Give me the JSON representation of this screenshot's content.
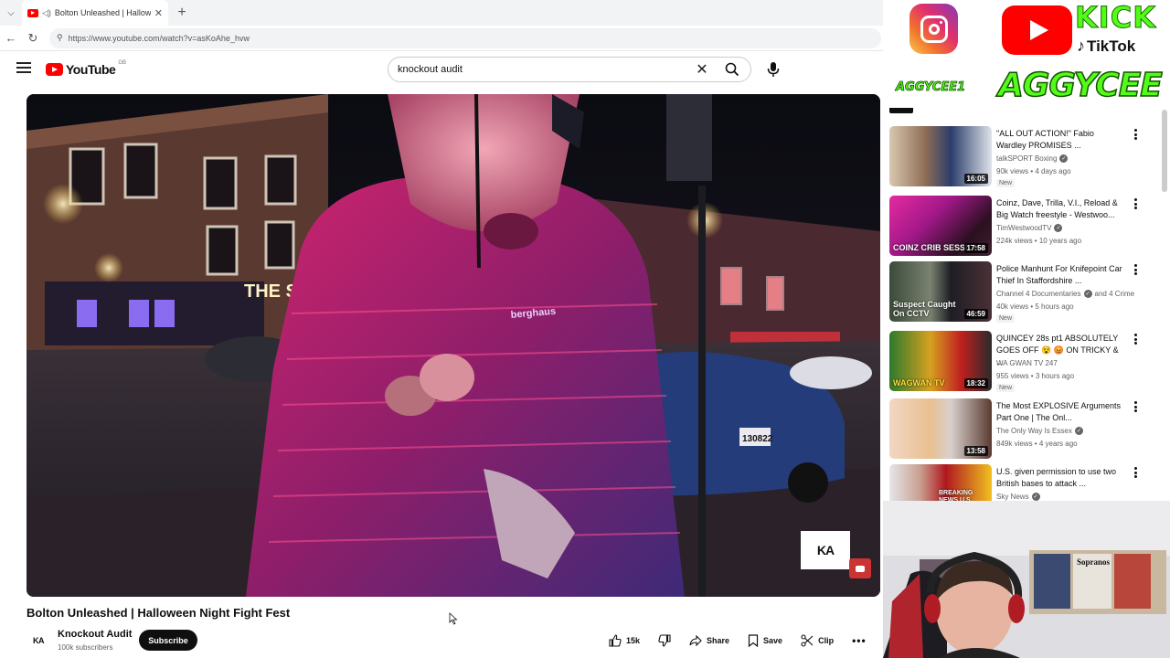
{
  "browser": {
    "tab_title": "Bolton Unleashed | Halloween",
    "url": "https://www.youtube.com/watch?v=asKoAhe_hvw"
  },
  "youtube": {
    "logo_text": "YouTube",
    "country_code": "GB",
    "search_query": "knockout audit"
  },
  "video": {
    "title": "Bolton Unleashed | Halloween Night Fight Fest",
    "overlay_logo": "KA",
    "scene_sign": "THE SWAN",
    "plate": "130822",
    "jacket_brand": "berghaus"
  },
  "channel": {
    "name": "Knockout Audit",
    "subscribers": "100k subscribers",
    "avatar_text": "KA",
    "subscribe_label": "Subscribe"
  },
  "actions": {
    "likes": "15k",
    "share_label": "Share",
    "save_label": "Save",
    "clip_label": "Clip"
  },
  "overlay": {
    "kick_label": "KICK",
    "tiktok_label": "TikTok",
    "handle_small": "AGGYCEE1",
    "handle_big": "AGGYCEE"
  },
  "recommendations": [
    {
      "title": "\"ALL OUT ACTION!\" Fabio Wardley PROMISES ...",
      "channel": "talkSPORT Boxing",
      "verified": true,
      "meta": "90k views • 4 days ago",
      "badge": "New",
      "duration": "16:05",
      "thumb_text": ""
    },
    {
      "title": "Coinz, Dave, Trilla, V.I., Reload & Big Watch freestyle - Westwoo...",
      "channel": "TimWestwoodTV",
      "verified": true,
      "meta": "224k views • 10 years ago",
      "badge": "",
      "duration": "17:58",
      "thumb_text": "COINZ CRIB SESSION"
    },
    {
      "title": "Police Manhunt For Knifepoint Car Thief In Staffordshire ...",
      "channel": "Channel 4 Documentaries",
      "channel_extra": "and 4 Crime",
      "verified": true,
      "meta": "40k views • 5 hours ago",
      "badge": "New",
      "duration": "46:59",
      "thumb_text": "Suspect Caught On CCTV"
    },
    {
      "title": "QUINCEY 28s pt1 ABSOLUTELY GOES OFF 😵 😡 ON TRICKY & ...",
      "channel": "WA GWAN TV 247",
      "verified": false,
      "meta": "955 views • 3 hours ago",
      "badge": "New",
      "duration": "18:32",
      "thumb_text": "WAGWAN TV"
    },
    {
      "title": "The Most EXPLOSIVE Arguments Part One | The Onl...",
      "channel": "The Only Way Is Essex",
      "verified": true,
      "meta": "849k views • 4 years ago",
      "badge": "",
      "duration": "13:58",
      "thumb_text": ""
    },
    {
      "title": "U.S. given permission to use two British bases to attack ...",
      "channel": "Sky News",
      "verified": true,
      "meta": "",
      "badge": "",
      "duration": "",
      "thumb_text": "BREAKING NEWS U.S. GIVEN ACCESS TO TWO"
    }
  ]
}
